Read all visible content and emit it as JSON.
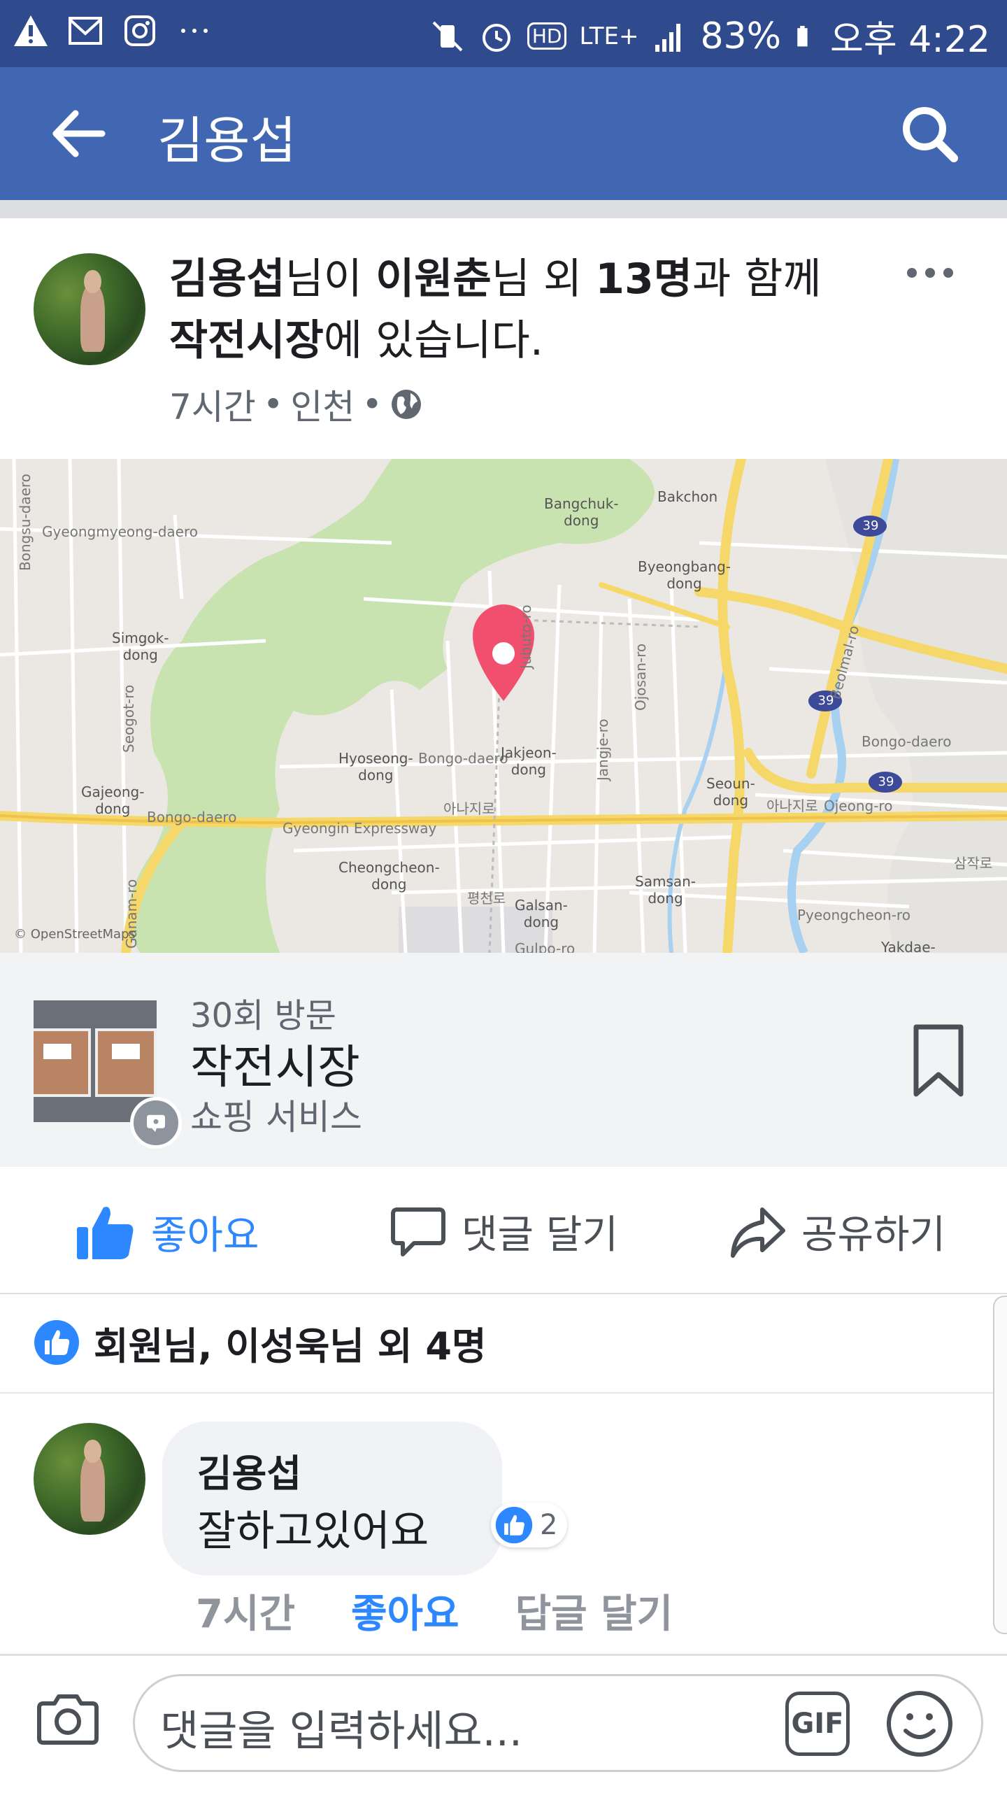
{
  "status_bar": {
    "battery": "83%",
    "time": "오후 4:22",
    "network": "LTE+",
    "hd": "HD"
  },
  "app_bar": {
    "title": "김용섭"
  },
  "post": {
    "author": "김용섭",
    "headline_parts": [
      "김용섭",
      "님이 ",
      "이원춘",
      "님 외 ",
      "13명",
      "과 함께 ",
      "작전시장",
      "에 있습니다."
    ],
    "time": "7시간",
    "location": "인천",
    "privacy_icon": "globe-icon"
  },
  "map": {
    "attribution": "© OpenStreetMaps",
    "labels": [
      {
        "t": "Bangchuk-\ndong"
      },
      {
        "t": "Bakchon"
      },
      {
        "t": "Byeongbang-\ndong"
      },
      {
        "t": "Gyeongmyeong-daero"
      },
      {
        "t": "Simgok-\ndong"
      },
      {
        "t": "Hyoseong-\ndong"
      },
      {
        "t": "Bongo-daero"
      },
      {
        "t": "Jakjeon-\ndong"
      },
      {
        "t": "Seoun-\ndong"
      },
      {
        "t": "Gajeong-\ndong"
      },
      {
        "t": "Bongo-daero"
      },
      {
        "t": "Gyeongin Expressway"
      },
      {
        "t": "아나지로"
      },
      {
        "t": "아나지로"
      },
      {
        "t": "Ojeong-ro"
      },
      {
        "t": "Bongo-daero"
      },
      {
        "t": "Cheongcheon-\ndong"
      },
      {
        "t": "Galsan-\ndong"
      },
      {
        "t": "Samsan-\ndong"
      },
      {
        "t": "Pyeongcheon-ro"
      },
      {
        "t": "Yakdae-"
      },
      {
        "t": "Gulpo-ro"
      },
      {
        "t": "평천로"
      },
      {
        "t": "삼작로"
      },
      {
        "t": "Jubuto-ro"
      },
      {
        "t": "Ojosan-ro"
      },
      {
        "t": "Jangje-ro"
      },
      {
        "t": "Beolmal-ro"
      },
      {
        "t": "Seogot-ro"
      },
      {
        "t": "Bongsu-daero"
      },
      {
        "t": "Ganam-ro"
      },
      {
        "t": "39"
      },
      {
        "t": "39"
      },
      {
        "t": "39"
      }
    ]
  },
  "place": {
    "visits": "30회 방문",
    "name": "작전시장",
    "category": "쇼핑 서비스"
  },
  "actions": {
    "like": "좋아요",
    "comment": "댓글 달기",
    "share": "공유하기"
  },
  "reactions": {
    "text": "회원님, 이성욱님 외 4명"
  },
  "comment": {
    "author": "김용섭",
    "text": "잘하고있어요",
    "reaction_count": "2",
    "time": "7시간",
    "like": "좋아요",
    "reply": "답글 달기"
  },
  "composer": {
    "placeholder": "댓글을 입력하세요...",
    "gif": "GIF"
  },
  "colors": {
    "brand": "#4267b2",
    "statusbar": "#2f4a8d",
    "like_blue": "#2d88ff",
    "pin": "#f0506e"
  }
}
